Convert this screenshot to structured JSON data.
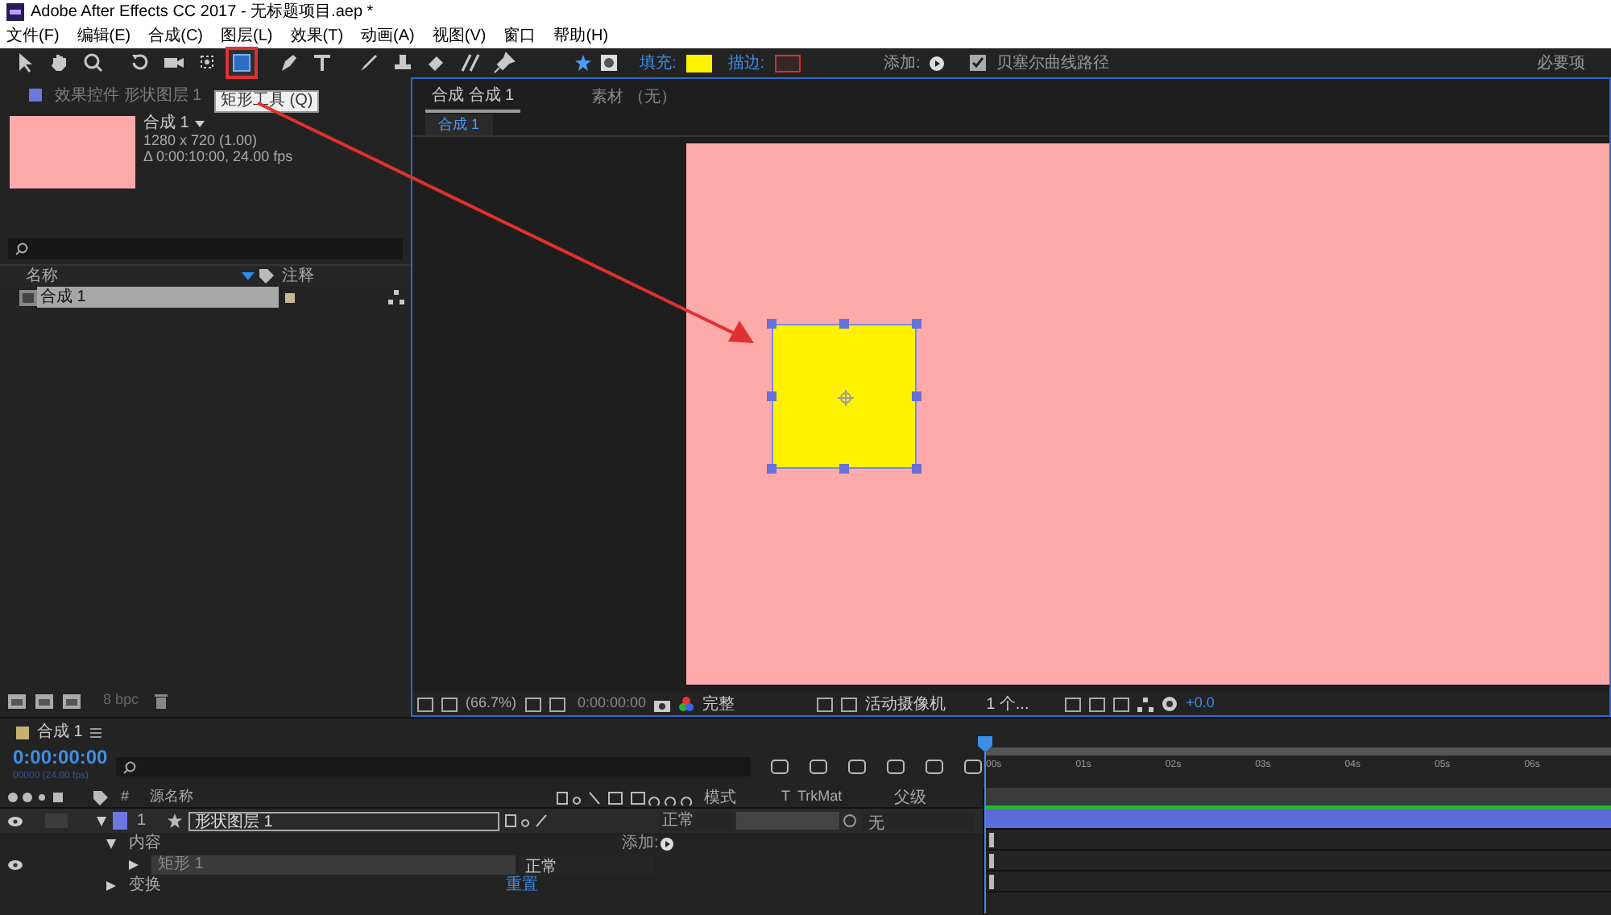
{
  "window": {
    "title": "Adobe After Effects CC 2017 - 无标题项目.aep *"
  },
  "menu": [
    "文件(F)",
    "编辑(E)",
    "合成(C)",
    "图层(L)",
    "效果(T)",
    "动画(A)",
    "视图(V)",
    "窗口",
    "帮助(H)"
  ],
  "toolbar": {
    "tools": [
      {
        "kind": "select",
        "selected": false
      },
      {
        "kind": "hand",
        "selected": false
      },
      {
        "kind": "zoom",
        "selected": false
      },
      {
        "kind": "rotate",
        "selected": false
      },
      {
        "kind": "camera",
        "selected": false
      },
      {
        "kind": "pan",
        "selected": false
      },
      {
        "kind": "rectangle",
        "selected": true
      },
      {
        "kind": "pen",
        "selected": false
      },
      {
        "kind": "text",
        "selected": false
      },
      {
        "kind": "brush",
        "selected": false
      },
      {
        "kind": "stamp",
        "selected": false
      },
      {
        "kind": "eraser",
        "selected": false
      },
      {
        "kind": "roto",
        "selected": false
      },
      {
        "kind": "pin",
        "selected": false
      }
    ],
    "tooltip": "矩形工具 (Q)",
    "fill_label": "填充:",
    "stroke_label": "描边:",
    "add_label": "添加:",
    "bezier": {
      "label": "贝塞尔曲线路径",
      "checked": true
    },
    "workspace": "必要项"
  },
  "project_panel": {
    "tab": "效果控件 形状图层 1",
    "comp_name": "合成 1",
    "dimensions": "1280 x 720 (1.00)",
    "duration": "Δ 0:00:10:00, 24.00 fps",
    "columns": [
      "名称",
      "注释"
    ],
    "items": [
      {
        "name": "合成 1",
        "selected": true
      }
    ],
    "depth": "8 bpc"
  },
  "composition_panel": {
    "tabs": [
      {
        "label": "合成 合成 1",
        "selected": true
      },
      {
        "label": "素材 （无）",
        "selected": false
      }
    ],
    "breadcrumb": "合成 1",
    "footer": {
      "zoom": "(66.7%)",
      "time": "0:00:00:00",
      "resolution": "完整",
      "camera": "活动摄像机",
      "views": "1 个...",
      "exposure": "+0.0"
    }
  },
  "timeline": {
    "tab": "合成 1",
    "time": "0:00:00:00",
    "frame": "00000 (24.00 fps)",
    "columns": [
      "#",
      "源名称",
      "模式",
      "T",
      "TrkMat",
      "父级"
    ],
    "layer": {
      "number": "1",
      "name": "形状图层 1",
      "mode": "正常",
      "parent": "无",
      "expanded": true
    },
    "properties": [
      {
        "label": "内容",
        "expanded": true,
        "action": "添加:",
        "children": [
          {
            "label": "矩形 1",
            "expanded": false,
            "mode": "正常"
          }
        ]
      },
      {
        "label": "变换",
        "expanded": false,
        "action": "重置"
      }
    ],
    "ruler": [
      "00s",
      "01s",
      "02s",
      "03s",
      "04s",
      "05s",
      "06s"
    ]
  }
}
